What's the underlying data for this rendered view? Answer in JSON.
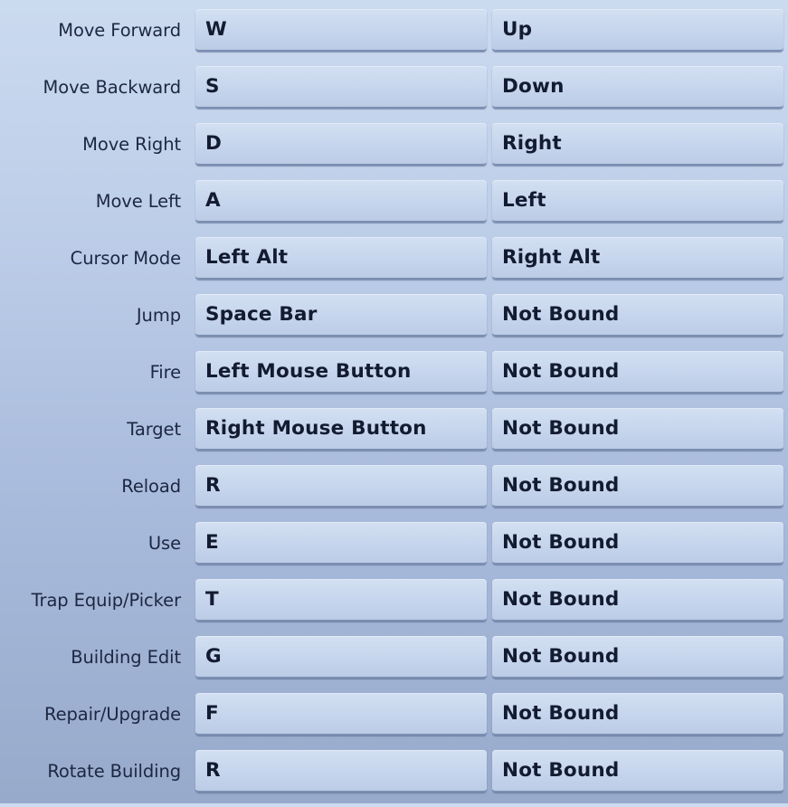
{
  "keybindings": [
    {
      "action": "Move Forward",
      "primary": "W",
      "secondary": "Up"
    },
    {
      "action": "Move Backward",
      "primary": "S",
      "secondary": "Down"
    },
    {
      "action": "Move Right",
      "primary": "D",
      "secondary": "Right"
    },
    {
      "action": "Move Left",
      "primary": "A",
      "secondary": "Left"
    },
    {
      "action": "Cursor Mode",
      "primary": "Left Alt",
      "secondary": "Right Alt"
    },
    {
      "action": "Jump",
      "primary": "Space Bar",
      "secondary": "Not Bound"
    },
    {
      "action": "Fire",
      "primary": "Left Mouse Button",
      "secondary": "Not Bound"
    },
    {
      "action": "Target",
      "primary": "Right Mouse Button",
      "secondary": "Not Bound"
    },
    {
      "action": "Reload",
      "primary": "R",
      "secondary": "Not Bound"
    },
    {
      "action": "Use",
      "primary": "E",
      "secondary": "Not Bound"
    },
    {
      "action": "Trap Equip/Picker",
      "primary": "T",
      "secondary": "Not Bound"
    },
    {
      "action": "Building Edit",
      "primary": "G",
      "secondary": "Not Bound"
    },
    {
      "action": "Repair/Upgrade",
      "primary": "F",
      "secondary": "Not Bound"
    },
    {
      "action": "Rotate Building",
      "primary": "R",
      "secondary": "Not Bound"
    }
  ]
}
